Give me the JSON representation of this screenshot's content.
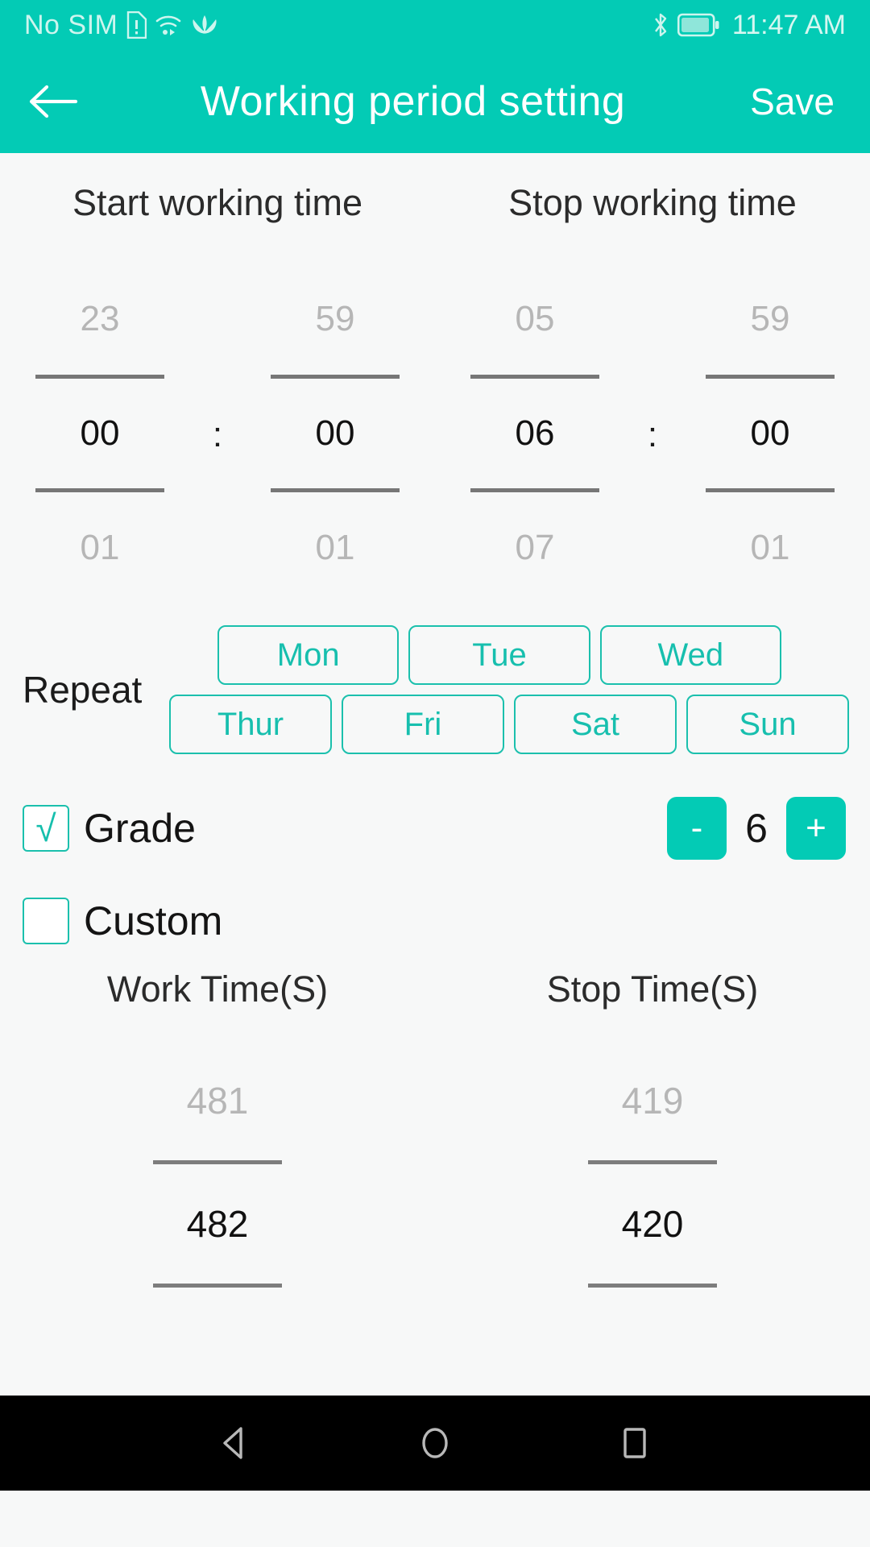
{
  "status_bar": {
    "carrier": "No SIM",
    "time": "11:47 AM",
    "icons": [
      "sim-error-icon",
      "wifi-icon",
      "huawei-logo-icon",
      "bluetooth-icon",
      "battery-icon"
    ]
  },
  "app_bar": {
    "back_icon": "back-arrow-icon",
    "title": "Working period setting",
    "save_label": "Save"
  },
  "time_section": {
    "start_header": "Start working time",
    "stop_header": "Stop working time",
    "separator": ":",
    "start": {
      "hour": {
        "prev": "23",
        "selected": "00",
        "next": "01"
      },
      "minute": {
        "prev": "59",
        "selected": "00",
        "next": "01"
      }
    },
    "stop": {
      "hour": {
        "prev": "05",
        "selected": "06",
        "next": "07"
      },
      "minute": {
        "prev": "59",
        "selected": "00",
        "next": "01"
      }
    }
  },
  "repeat": {
    "label": "Repeat",
    "days_row1": [
      "Mon",
      "Tue",
      "Wed"
    ],
    "days_row2": [
      "Thur",
      "Fri",
      "Sat",
      "Sun"
    ]
  },
  "grade": {
    "label": "Grade",
    "checked": true,
    "check_glyph": "√",
    "minus_label": "-",
    "plus_label": "+",
    "value": "6"
  },
  "custom": {
    "label": "Custom",
    "checked": false,
    "work_header": "Work Time(S)",
    "stop_header": "Stop Time(S)",
    "work": {
      "prev": "481",
      "selected": "482"
    },
    "stop": {
      "prev": "419",
      "selected": "420"
    }
  },
  "nav_bar": {
    "back": "nav-back-icon",
    "home": "nav-home-icon",
    "recents": "nav-recents-icon"
  },
  "colors": {
    "accent": "#03CBB5",
    "accent_outline": "#1bc0ad",
    "dim_text": "#b6b6b6",
    "page_bg": "#f7f8f8"
  }
}
